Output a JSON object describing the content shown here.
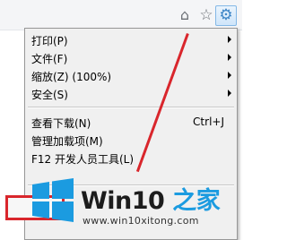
{
  "toolbar": {
    "home_icon": "home-icon",
    "star_icon": "star-icon",
    "gear_icon": "gear-icon"
  },
  "menu": {
    "items": [
      {
        "label": "打印(P)",
        "submenu": true
      },
      {
        "label": "文件(F)",
        "submenu": true
      },
      {
        "label": "缩放(Z) (100%)",
        "submenu": true
      },
      {
        "label": "安全(S)",
        "submenu": true
      },
      {
        "label": "查看下载(N)",
        "shortcut": "Ctrl+J"
      },
      {
        "label": "管理加载项(M)"
      },
      {
        "label": "F12 开发人员工具(L)"
      }
    ]
  },
  "watermark": {
    "brand_main": "Win10",
    "brand_accent": " 之家",
    "url": "www.win10xitong.com"
  },
  "colors": {
    "annotation": "#d9262c",
    "accent": "#1b9be0"
  }
}
